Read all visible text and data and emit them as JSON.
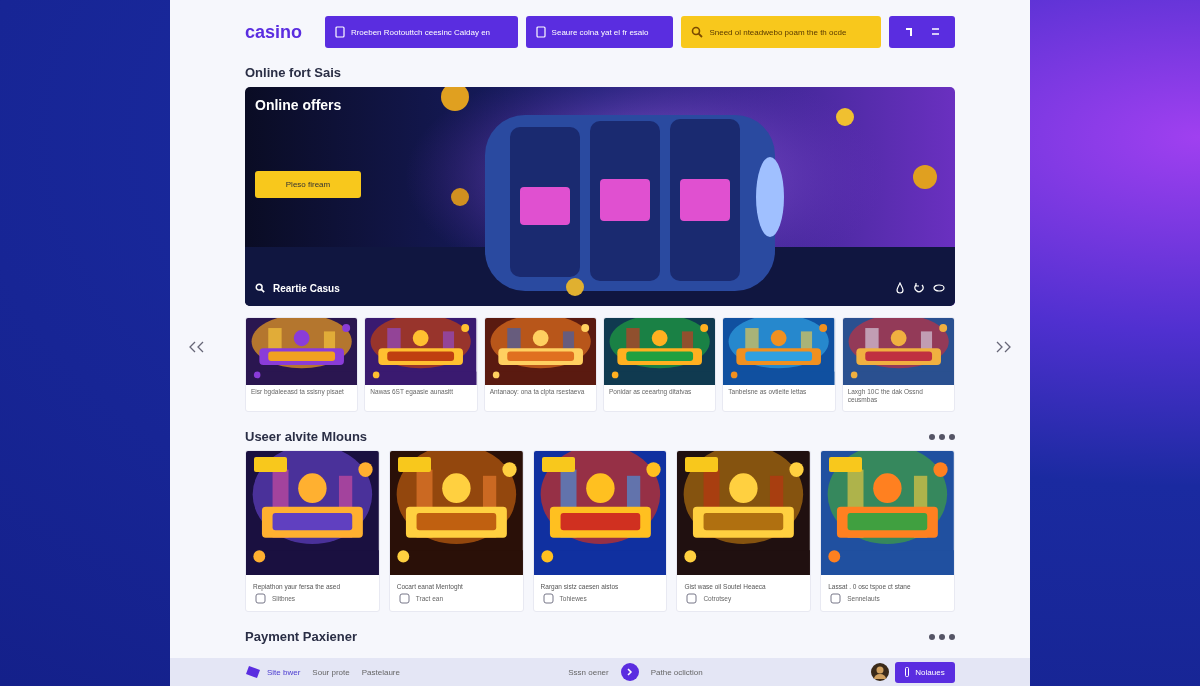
{
  "header": {
    "logo": "casino",
    "buttons": [
      {
        "kind": "nav",
        "label": "Rroeben Rootouttch ceesinc Calday en"
      },
      {
        "kind": "nav",
        "label": "Seaure colna yat el fr esaio"
      },
      {
        "kind": "search",
        "label": "Sneed ol nteadwebo poam the th ocde"
      }
    ]
  },
  "offers": {
    "heading": "Online fort Sais",
    "title": "Online offers",
    "button": "Pleso fiream",
    "caption": "Reartie Casus"
  },
  "featured": [
    {
      "caption": "Eisr bgdaleeasd ta ssisny pisaet"
    },
    {
      "caption": "Nawas 6ST egaasie aunasitt"
    },
    {
      "caption": "Antanaoy: ona ta clpta rsestaeva"
    },
    {
      "caption": "Ponidar as ceeartng ditatvas"
    },
    {
      "caption": "Tanbelsne as ovtieite lettas"
    },
    {
      "caption": "Laxgh 10C the dak Ossnd ceusmbas"
    }
  ],
  "popular": {
    "heading": "Useer alvite Mlouns",
    "cards": [
      {
        "caption": "Repiathon yaur fersa the ased",
        "meta": "Slitbnes"
      },
      {
        "caption": "Cocart eanat Mentoght",
        "meta": "Tract ean"
      },
      {
        "caption": "Rargan sistz caesen aistos",
        "meta": "Tohiewes"
      },
      {
        "caption": "Gist wase oil Soutel Heaeca",
        "meta": "Cotrotsey"
      },
      {
        "caption": "Lassat . 0 osc tspoe ct stane",
        "meta": "Sennelauts"
      }
    ]
  },
  "payment": {
    "heading": "Payment Paxiener"
  },
  "footer": {
    "brand": "Site bwer",
    "links": [
      "Sour prote",
      "Pastelaure"
    ],
    "status": "Sssn oener",
    "action": "Pathe ocliction",
    "button": "Nolaues"
  }
}
